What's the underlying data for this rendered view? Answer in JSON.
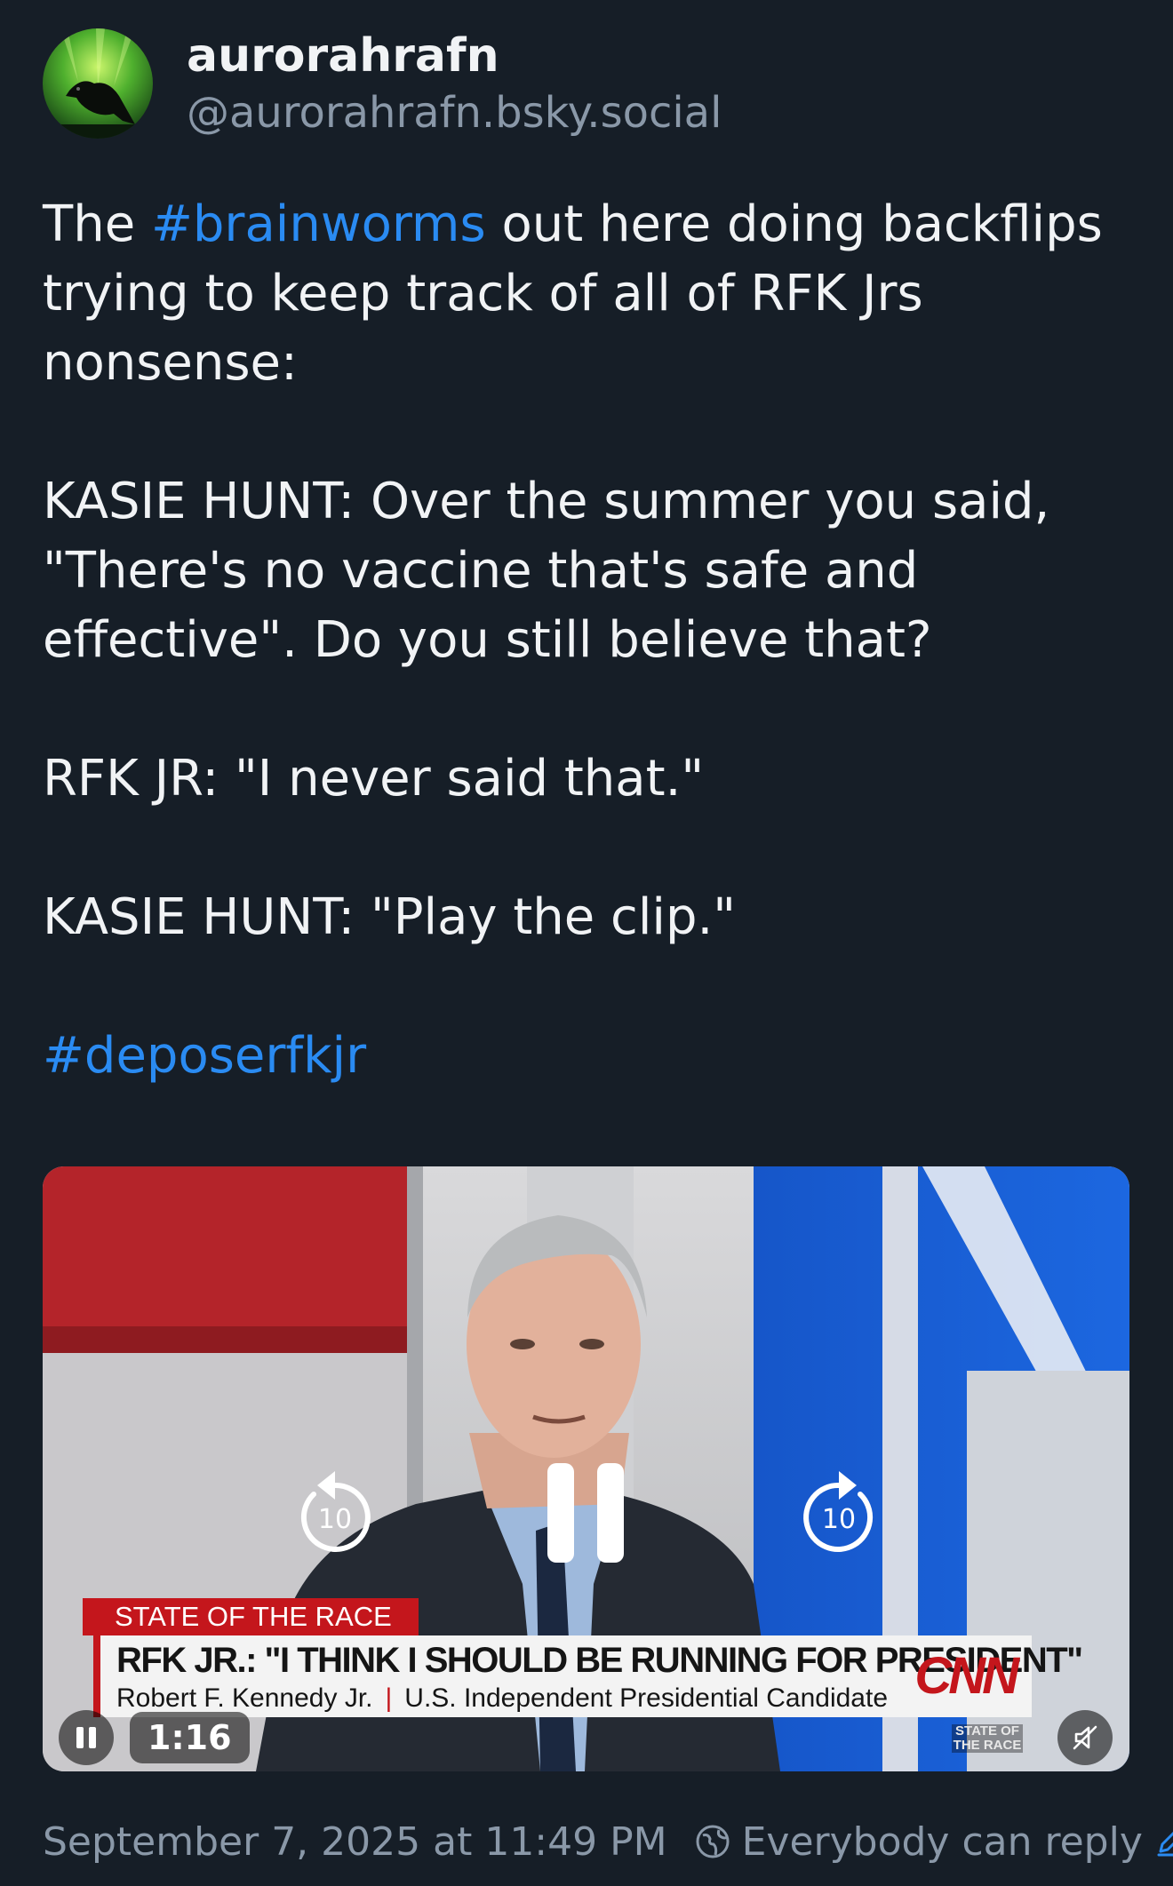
{
  "author": {
    "display_name": "aurorahrafn",
    "handle": "@aurorahrafn.bsky.social",
    "avatar_icon": "raven-aurora-avatar"
  },
  "post": {
    "line1_pre": "The ",
    "line1_tag": "#brainworms",
    "line1_post": " out here doing backflips trying to keep track of all of RFK Jrs nonsense:",
    "para2": "KASIE HUNT: Over the summer you said, \"There's no vaccine that's safe and effective\". Do you still believe that?",
    "para3": "RFK JR: \"I never said that.\"",
    "para4": "KASIE HUNT: \"Play the clip.\"",
    "tag2": "#deposerfkjr"
  },
  "video": {
    "chyron_tag": "STATE OF THE RACE",
    "chyron_headline": "RFK JR.: \"I THINK I SHOULD BE RUNNING FOR PRESIDENT\"",
    "chyron_name": "Robert F. Kennedy Jr.",
    "chyron_separator": "|",
    "chyron_title": "U.S. Independent Presidential Candidate",
    "network_logo": "CNN",
    "bug_line1": "STATE OF",
    "bug_line2": "THE RACE",
    "skip_back_label": "10",
    "skip_forward_label": "10",
    "time": "1:16"
  },
  "footer": {
    "timestamp": "September 7, 2025 at 11:49 PM",
    "reply_setting": "Everybody can reply"
  },
  "colors": {
    "background": "#161e27",
    "text": "#f1f3f5",
    "muted": "#8a98a8",
    "link": "#2a8bf2",
    "cnn_red": "#c4161c"
  }
}
